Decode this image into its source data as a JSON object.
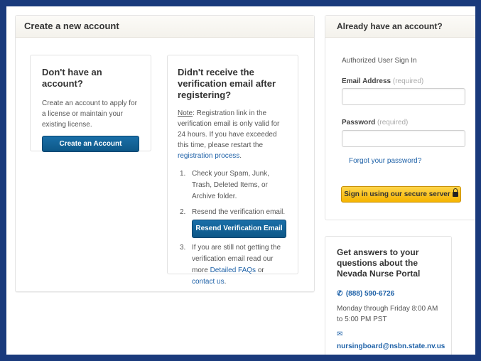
{
  "create_panel": {
    "title": "Create a new account",
    "no_account": {
      "heading": "Don't have an account?",
      "text": "Create an account to apply for a license or maintain your existing license.",
      "button": "Create an Account"
    },
    "no_verification": {
      "heading": "Didn't receive the verification email after registering?",
      "note_label": "Note",
      "note_text": ": Registration link in the verification email is only valid for 24 hours. If you have exceeded this time, please restart the ",
      "note_link": "registration process",
      "note_end": ".",
      "steps": [
        {
          "num": "1.",
          "text": "Check your Spam, Junk, Trash, Deleted Items, or Archive folder."
        },
        {
          "num": "2.",
          "text": "Resend the verification email."
        },
        {
          "num": "3.",
          "text_before": "If you are still not getting the verification email read our more ",
          "link1": "Detailed FAQs",
          "text_mid": " or ",
          "link2": "contact us",
          "text_end": "."
        }
      ],
      "resend_button": "Resend Verification Email"
    }
  },
  "signin_panel": {
    "title": "Already have an account?",
    "subtitle": "Authorized User Sign In",
    "email_label": "Email Address",
    "email_req": "(required)",
    "email_value": "",
    "password_label": "Password",
    "password_req": "(required)",
    "password_value": "",
    "forgot": "Forgot your password?",
    "signin_button": "Sign in using our secure server"
  },
  "help": {
    "heading": "Get answers to your questions about the Nevada Nurse Portal",
    "phone": "(888) 590-6726",
    "hours": "Monday through Friday 8:00 AM to 5:00 PM PST",
    "email": "nursingboard@nsbn.state.nv.us",
    "phone_icon": "phone-icon",
    "email_icon": "envelope-icon"
  },
  "colors": {
    "frame": "#1a3a7c",
    "primary_button": "#0d5787",
    "signin_button": "#f5b400",
    "link": "#1f62a8"
  }
}
